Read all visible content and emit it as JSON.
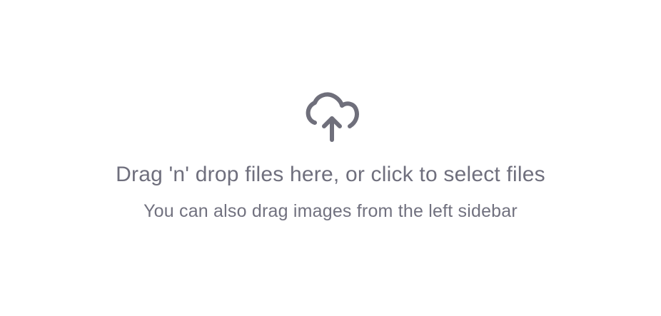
{
  "dropzone": {
    "icon": "cloud-upload-icon",
    "icon_color": "#6f6f7b",
    "text_color": "#6f6f7d",
    "primary_text": "Drag 'n' drop files here, or click to select files",
    "secondary_text": "You can also drag images from the left sidebar"
  }
}
